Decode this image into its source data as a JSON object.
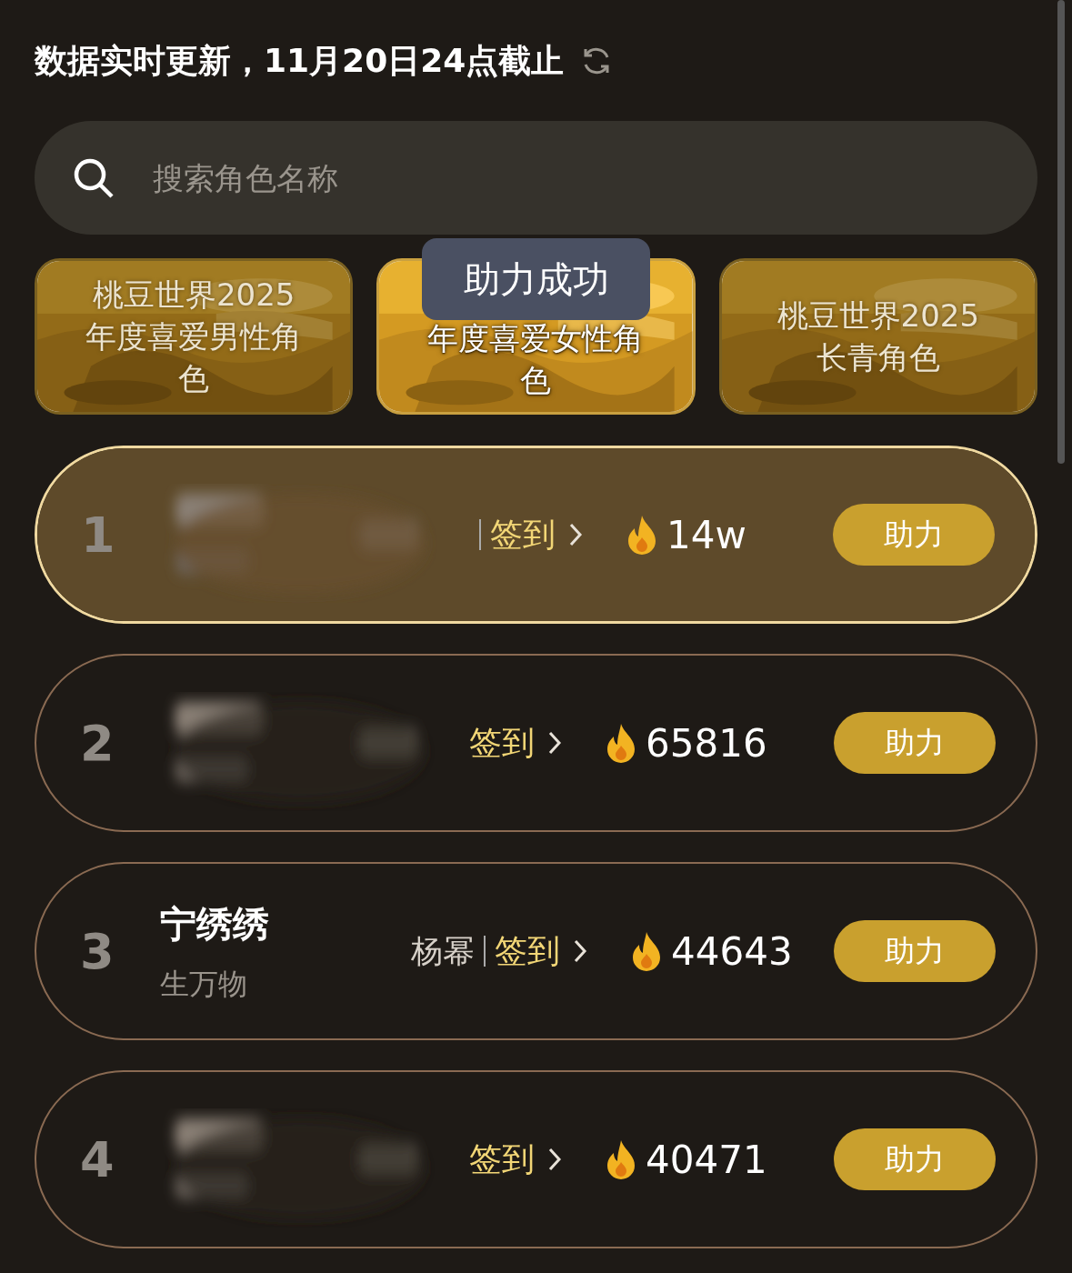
{
  "header": {
    "text": "数据实时更新，11月20日24点截止"
  },
  "search": {
    "placeholder": "搜索角色名称"
  },
  "tabs": [
    {
      "lines": [
        "桃豆世界2025",
        "年度喜爱男性角",
        "色"
      ],
      "selected": false
    },
    {
      "lines": [
        "年度喜爱女性角",
        "色"
      ],
      "selected": true
    },
    {
      "lines": [
        "桃豆世界2025",
        "长青角色"
      ],
      "selected": false
    }
  ],
  "toast": {
    "text": "助力成功"
  },
  "rows": [
    {
      "rank": "1",
      "highlighted": true,
      "redacted": true,
      "divider": true,
      "checkin": "签到",
      "heat": "14w",
      "button": "助力"
    },
    {
      "rank": "2",
      "highlighted": false,
      "redacted": true,
      "divider": false,
      "checkin": "签到",
      "heat": "65816",
      "button": "助力"
    },
    {
      "rank": "3",
      "highlighted": false,
      "redacted": false,
      "name": "宁绣绣",
      "subtitle": "生万物",
      "actor": "杨幂",
      "divider": true,
      "checkin": "签到",
      "heat": "44643",
      "button": "助力"
    },
    {
      "rank": "4",
      "highlighted": false,
      "redacted": true,
      "divider": false,
      "checkin": "签到",
      "heat": "40471",
      "button": "助力"
    }
  ]
}
